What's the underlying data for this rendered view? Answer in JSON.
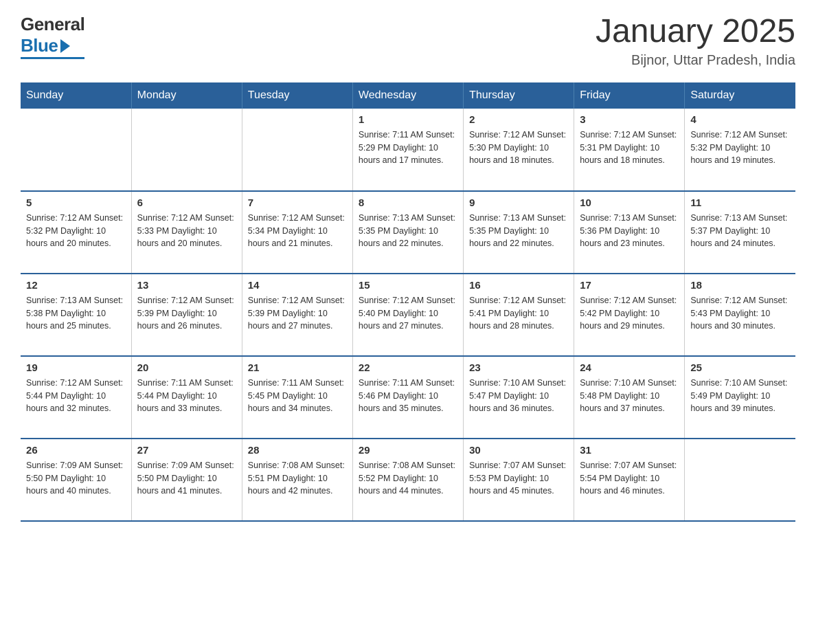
{
  "header": {
    "logo_general": "General",
    "logo_blue": "Blue",
    "month_title": "January 2025",
    "location": "Bijnor, Uttar Pradesh, India"
  },
  "days_of_week": [
    "Sunday",
    "Monday",
    "Tuesday",
    "Wednesday",
    "Thursday",
    "Friday",
    "Saturday"
  ],
  "weeks": [
    [
      {
        "day": "",
        "info": ""
      },
      {
        "day": "",
        "info": ""
      },
      {
        "day": "",
        "info": ""
      },
      {
        "day": "1",
        "info": "Sunrise: 7:11 AM\nSunset: 5:29 PM\nDaylight: 10 hours\nand 17 minutes."
      },
      {
        "day": "2",
        "info": "Sunrise: 7:12 AM\nSunset: 5:30 PM\nDaylight: 10 hours\nand 18 minutes."
      },
      {
        "day": "3",
        "info": "Sunrise: 7:12 AM\nSunset: 5:31 PM\nDaylight: 10 hours\nand 18 minutes."
      },
      {
        "day": "4",
        "info": "Sunrise: 7:12 AM\nSunset: 5:32 PM\nDaylight: 10 hours\nand 19 minutes."
      }
    ],
    [
      {
        "day": "5",
        "info": "Sunrise: 7:12 AM\nSunset: 5:32 PM\nDaylight: 10 hours\nand 20 minutes."
      },
      {
        "day": "6",
        "info": "Sunrise: 7:12 AM\nSunset: 5:33 PM\nDaylight: 10 hours\nand 20 minutes."
      },
      {
        "day": "7",
        "info": "Sunrise: 7:12 AM\nSunset: 5:34 PM\nDaylight: 10 hours\nand 21 minutes."
      },
      {
        "day": "8",
        "info": "Sunrise: 7:13 AM\nSunset: 5:35 PM\nDaylight: 10 hours\nand 22 minutes."
      },
      {
        "day": "9",
        "info": "Sunrise: 7:13 AM\nSunset: 5:35 PM\nDaylight: 10 hours\nand 22 minutes."
      },
      {
        "day": "10",
        "info": "Sunrise: 7:13 AM\nSunset: 5:36 PM\nDaylight: 10 hours\nand 23 minutes."
      },
      {
        "day": "11",
        "info": "Sunrise: 7:13 AM\nSunset: 5:37 PM\nDaylight: 10 hours\nand 24 minutes."
      }
    ],
    [
      {
        "day": "12",
        "info": "Sunrise: 7:13 AM\nSunset: 5:38 PM\nDaylight: 10 hours\nand 25 minutes."
      },
      {
        "day": "13",
        "info": "Sunrise: 7:12 AM\nSunset: 5:39 PM\nDaylight: 10 hours\nand 26 minutes."
      },
      {
        "day": "14",
        "info": "Sunrise: 7:12 AM\nSunset: 5:39 PM\nDaylight: 10 hours\nand 27 minutes."
      },
      {
        "day": "15",
        "info": "Sunrise: 7:12 AM\nSunset: 5:40 PM\nDaylight: 10 hours\nand 27 minutes."
      },
      {
        "day": "16",
        "info": "Sunrise: 7:12 AM\nSunset: 5:41 PM\nDaylight: 10 hours\nand 28 minutes."
      },
      {
        "day": "17",
        "info": "Sunrise: 7:12 AM\nSunset: 5:42 PM\nDaylight: 10 hours\nand 29 minutes."
      },
      {
        "day": "18",
        "info": "Sunrise: 7:12 AM\nSunset: 5:43 PM\nDaylight: 10 hours\nand 30 minutes."
      }
    ],
    [
      {
        "day": "19",
        "info": "Sunrise: 7:12 AM\nSunset: 5:44 PM\nDaylight: 10 hours\nand 32 minutes."
      },
      {
        "day": "20",
        "info": "Sunrise: 7:11 AM\nSunset: 5:44 PM\nDaylight: 10 hours\nand 33 minutes."
      },
      {
        "day": "21",
        "info": "Sunrise: 7:11 AM\nSunset: 5:45 PM\nDaylight: 10 hours\nand 34 minutes."
      },
      {
        "day": "22",
        "info": "Sunrise: 7:11 AM\nSunset: 5:46 PM\nDaylight: 10 hours\nand 35 minutes."
      },
      {
        "day": "23",
        "info": "Sunrise: 7:10 AM\nSunset: 5:47 PM\nDaylight: 10 hours\nand 36 minutes."
      },
      {
        "day": "24",
        "info": "Sunrise: 7:10 AM\nSunset: 5:48 PM\nDaylight: 10 hours\nand 37 minutes."
      },
      {
        "day": "25",
        "info": "Sunrise: 7:10 AM\nSunset: 5:49 PM\nDaylight: 10 hours\nand 39 minutes."
      }
    ],
    [
      {
        "day": "26",
        "info": "Sunrise: 7:09 AM\nSunset: 5:50 PM\nDaylight: 10 hours\nand 40 minutes."
      },
      {
        "day": "27",
        "info": "Sunrise: 7:09 AM\nSunset: 5:50 PM\nDaylight: 10 hours\nand 41 minutes."
      },
      {
        "day": "28",
        "info": "Sunrise: 7:08 AM\nSunset: 5:51 PM\nDaylight: 10 hours\nand 42 minutes."
      },
      {
        "day": "29",
        "info": "Sunrise: 7:08 AM\nSunset: 5:52 PM\nDaylight: 10 hours\nand 44 minutes."
      },
      {
        "day": "30",
        "info": "Sunrise: 7:07 AM\nSunset: 5:53 PM\nDaylight: 10 hours\nand 45 minutes."
      },
      {
        "day": "31",
        "info": "Sunrise: 7:07 AM\nSunset: 5:54 PM\nDaylight: 10 hours\nand 46 minutes."
      },
      {
        "day": "",
        "info": ""
      }
    ]
  ]
}
